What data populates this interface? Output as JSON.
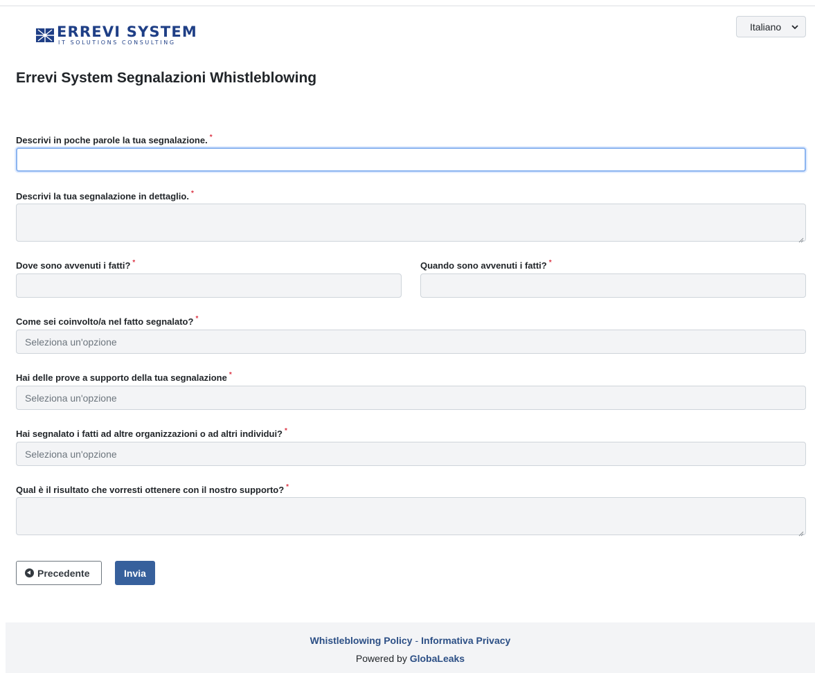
{
  "brand": {
    "name": "ERREVI SYSTEM",
    "tagline": "IT SOLUTIONS CONSULTING",
    "color": "#1f3f86"
  },
  "language_selector": {
    "value": "Italiano"
  },
  "page": {
    "title": "Errevi System Segnalazioni Whistleblowing"
  },
  "form": {
    "required_marker": "*",
    "fields": {
      "summary": {
        "label": "Descrivi in poche parole la tua segnalazione.",
        "value": ""
      },
      "details": {
        "label": "Descrivi la tua segnalazione in dettaglio.",
        "value": ""
      },
      "where": {
        "label": "Dove sono avvenuti i fatti?",
        "value": ""
      },
      "when": {
        "label": "Quando sono avvenuti i fatti?",
        "value": ""
      },
      "involvement": {
        "label": "Come sei coinvolto/a nel fatto segnalato?",
        "value": "Seleziona un'opzione"
      },
      "evidence": {
        "label": "Hai delle prove a supporto della tua segnalazione",
        "value": "Seleziona un'opzione"
      },
      "reported_elsewhere": {
        "label": "Hai segnalato i fatti ad altre organizzazioni o ad altri individui?",
        "value": "Seleziona un'opzione"
      },
      "desired_outcome": {
        "label": "Qual è il risultato che vorresti ottenere con il nostro supporto?",
        "value": ""
      }
    },
    "buttons": {
      "previous": "Precedente",
      "submit": "Invia"
    }
  },
  "footer": {
    "policy_link": "Whistleblowing Policy",
    "separator": "-",
    "privacy_link": "Informativa Privacy",
    "powered_prefix": "Powered by",
    "powered_brand": "GlobaLeaks"
  },
  "colors": {
    "accent": "#37609c",
    "link": "#2c4f85",
    "required": "#dc3545",
    "input_bg": "#f3f4f6",
    "focus_border": "#8bb4f0"
  },
  "icons": {
    "logo": "errevi-star-logo",
    "language_chevron": "chevron-down-icon",
    "previous": "arrow-circle-left-icon"
  }
}
